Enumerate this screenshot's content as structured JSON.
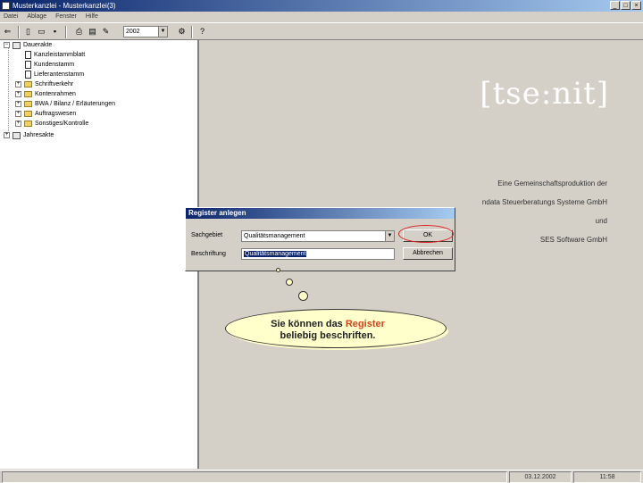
{
  "window": {
    "title": "Musterkanzlei - Musterkanzlei(3)"
  },
  "menu": [
    "Datei",
    "Ablage",
    "Fenster",
    "Hilfe"
  ],
  "toolbar": {
    "year": "2002"
  },
  "tree": {
    "root": "Dauerakte",
    "items": [
      {
        "label": "Kanzleistammblatt",
        "type": "doc"
      },
      {
        "label": "Kundenstamm",
        "type": "doc"
      },
      {
        "label": "Lieferantenstamm",
        "type": "doc"
      },
      {
        "label": "Schriftverkehr",
        "type": "folder"
      },
      {
        "label": "Kontenrahmen",
        "type": "folder"
      },
      {
        "label": "BWA / Bilanz / Erläuterungen",
        "type": "folder"
      },
      {
        "label": "Auftragswesen",
        "type": "folder"
      },
      {
        "label": "Sonstiges/Kontrolle",
        "type": "folder"
      }
    ],
    "second_root": "Jahresakte"
  },
  "logo": "[tse:nit]",
  "credits": [
    "Eine Gemeinschaftsproduktion der",
    "ndata Steuerberatungs Systeme GmbH",
    "und",
    "SES Software GmbH"
  ],
  "dialog": {
    "title": "Register anlegen",
    "sachgebiet_label": "Sachgebiet",
    "sachgebiet_value": "Qualitätsmanagement",
    "beschriftung_label": "Beschriftung",
    "beschriftung_value": "Qualitätsmanagement",
    "ok_label": "OK",
    "cancel_label": "Abbrechen"
  },
  "tooltip": {
    "part1": "Sie können das ",
    "highlight": "Register",
    "part2": "beliebig beschriften."
  },
  "status": {
    "date": "03.12.2002",
    "time": "11:58"
  }
}
